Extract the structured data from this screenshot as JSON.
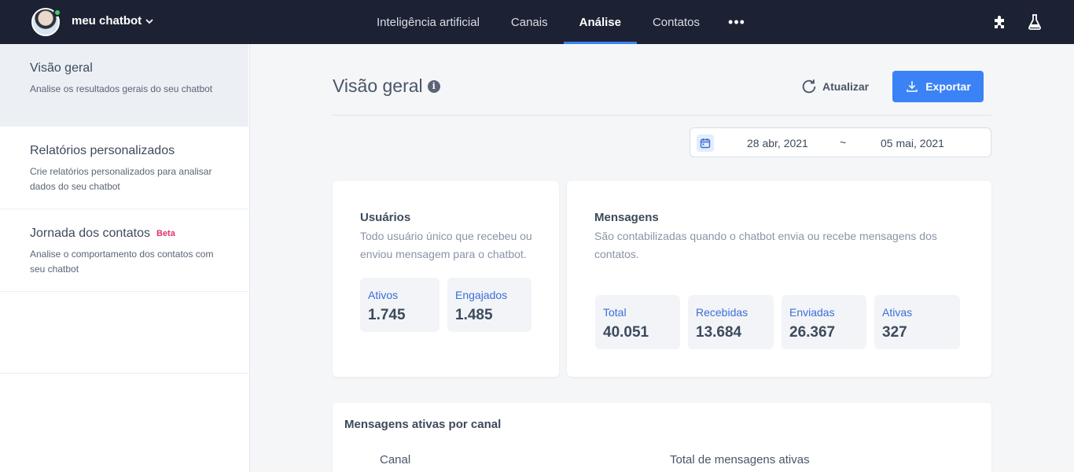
{
  "topbar": {
    "bot_name": "meu chatbot",
    "nav": [
      {
        "label": "Inteligência artificial"
      },
      {
        "label": "Canais"
      },
      {
        "label": "Análise"
      },
      {
        "label": "Contatos"
      }
    ],
    "more": "•••",
    "accent": "#3b82f6",
    "background": "#1c2233",
    "icons": [
      "puzzle-icon",
      "flask-icon"
    ]
  },
  "sidebar": {
    "items": [
      {
        "title": "Visão geral",
        "desc": "Analise os resultados gerais do seu chatbot"
      },
      {
        "title": "Relatórios personalizados",
        "desc": "Crie relatórios personalizados para analisar dados do seu chatbot"
      },
      {
        "title": "Jornada dos contatos",
        "badge": "Beta",
        "desc": "Analise o comportamento dos contatos com seu chatbot"
      }
    ]
  },
  "main": {
    "title": "Visão geral",
    "info": "i",
    "refresh_label": "Atualizar",
    "export_label": "Exportar",
    "date_start": "28 abr, 2021",
    "date_sep": "~",
    "date_end": "05 mai, 2021",
    "users_card": {
      "title": "Usuários",
      "desc_line1": "Todo usuário único que recebeu ou",
      "desc_line2": "enviou mensagem para o chatbot.",
      "stats": [
        {
          "label": "Ativos",
          "value": "1.745"
        },
        {
          "label": "Engajados",
          "value": "1.485"
        }
      ]
    },
    "messages_card": {
      "title": "Mensagens",
      "desc_line1": "São contabilizadas quando o chatbot envia ou recebe mensagens dos",
      "desc_line2": "contatos.",
      "stats": [
        {
          "label": "Total",
          "value": "40.051"
        },
        {
          "label": "Recebidas",
          "value": "13.684"
        },
        {
          "label": "Enviadas",
          "value": "26.367"
        },
        {
          "label": "Ativas",
          "value": "327"
        }
      ]
    },
    "channel_card": {
      "title": "Mensagens ativas por canal",
      "col_channel": "Canal",
      "col_total": "Total de mensagens ativas"
    }
  }
}
